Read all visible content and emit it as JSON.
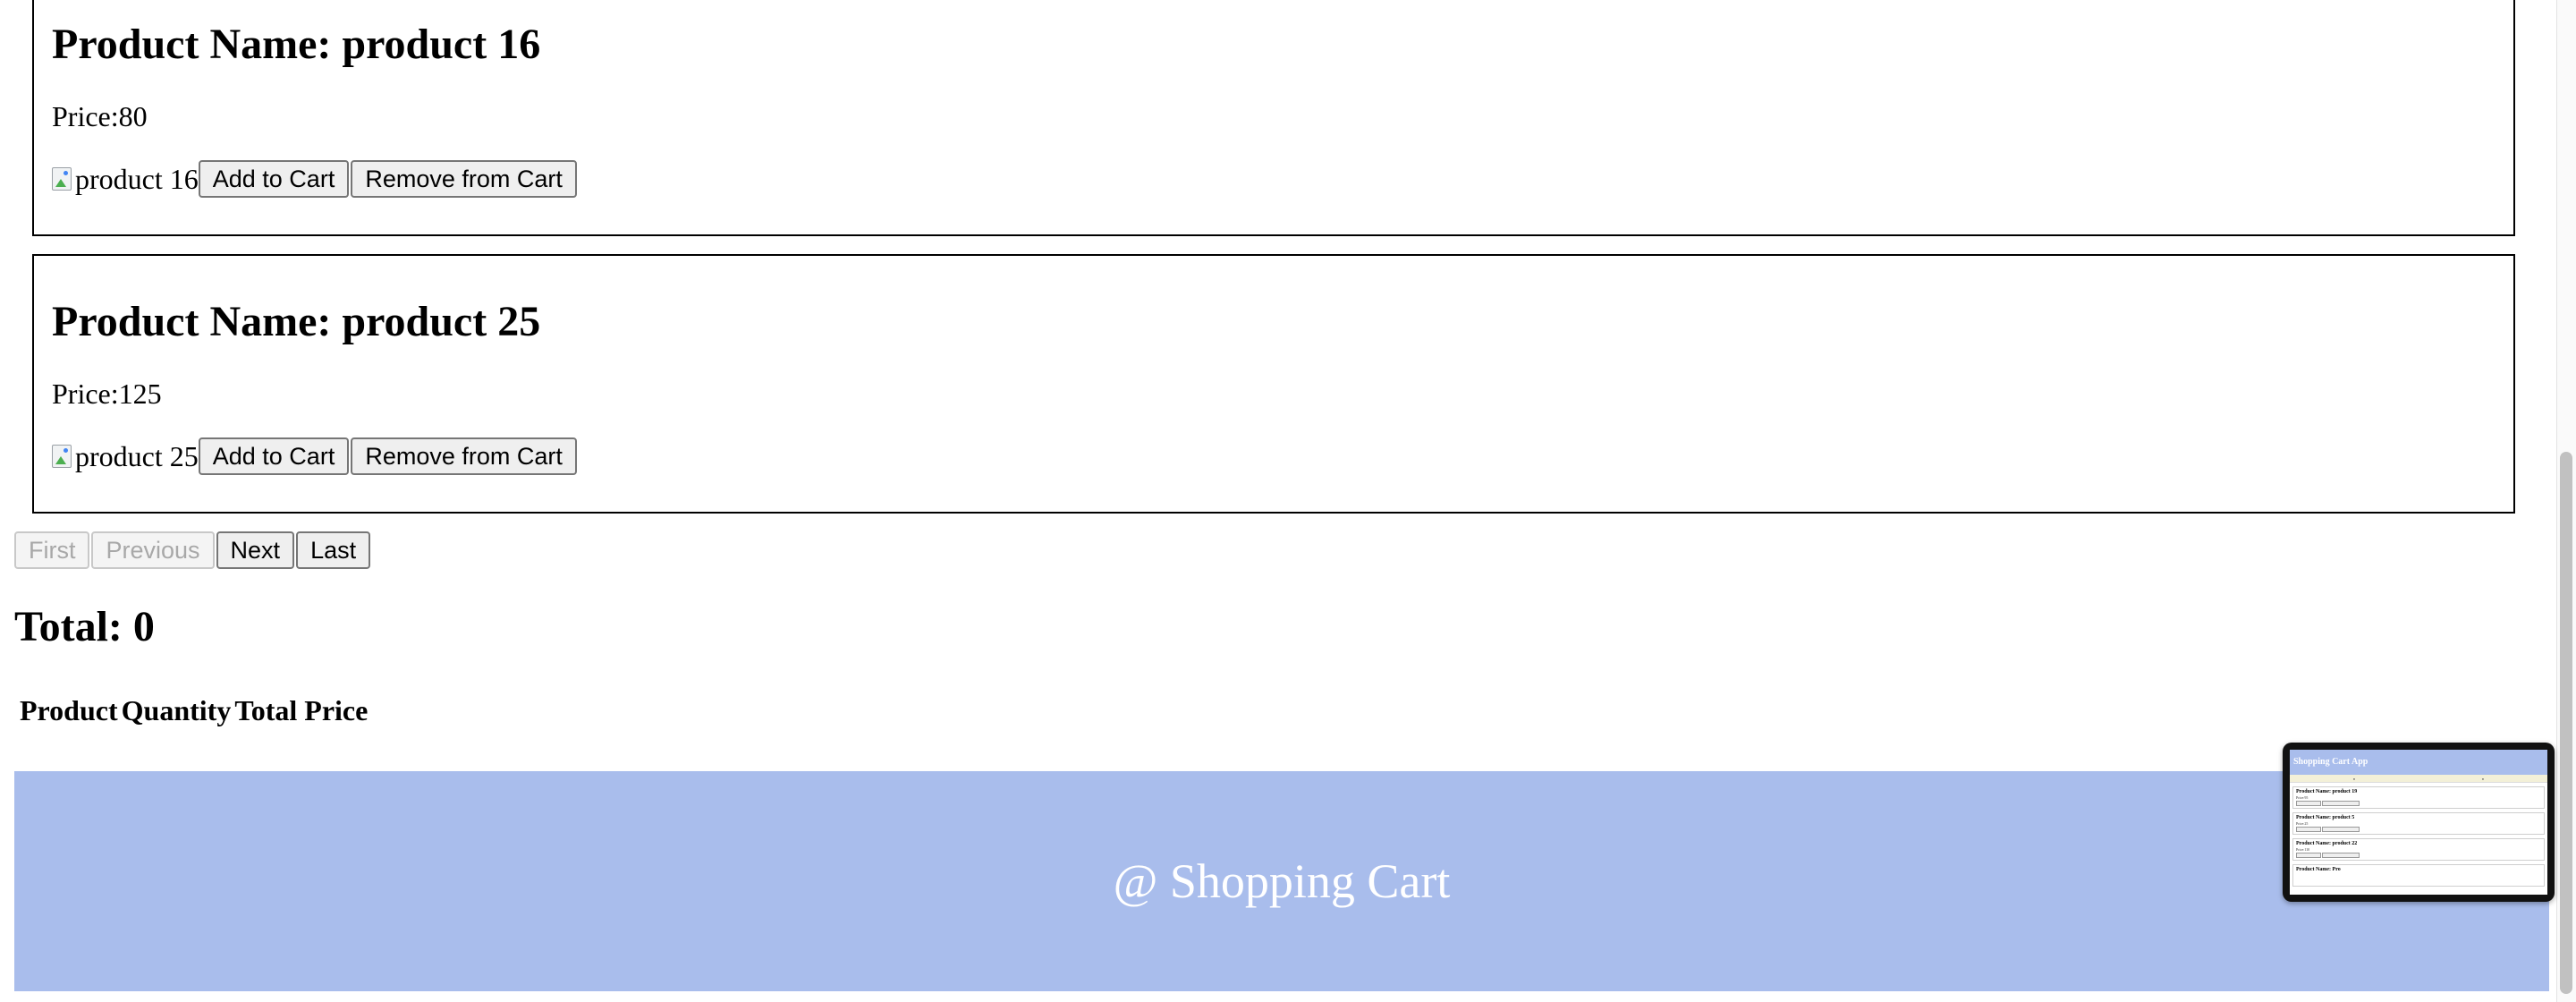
{
  "products": [
    {
      "title": "Product Name: product 16",
      "price": "Price:80",
      "image_alt": "product 16",
      "add_label": "Add to Cart",
      "remove_label": "Remove from Cart"
    },
    {
      "title": "Product Name: product 25",
      "price": "Price:125",
      "image_alt": "product 25",
      "add_label": "Add to Cart",
      "remove_label": "Remove from Cart"
    }
  ],
  "pagination": {
    "first": "First",
    "previous": "Previous",
    "next": "Next",
    "last": "Last",
    "first_disabled": true,
    "previous_disabled": true
  },
  "cart": {
    "total": "Total: 0",
    "columns": [
      "Product",
      "Quantity",
      "Total Price"
    ]
  },
  "footer": {
    "text": "@ Shopping Cart"
  },
  "preview": {
    "header": "Shopping Cart App",
    "cards": [
      {
        "title": "Product Name: product 19",
        "line": "Price:95"
      },
      {
        "title": "Product Name: product 5",
        "line": "Price:25"
      },
      {
        "title": "Product Name: product 22",
        "line": "Price:110"
      },
      {
        "title": "Product Name: Pro",
        "line": ""
      }
    ]
  },
  "colors": {
    "footer_bg": "#a9bdec",
    "footer_text": "#ffffff",
    "card_border": "#000000"
  }
}
